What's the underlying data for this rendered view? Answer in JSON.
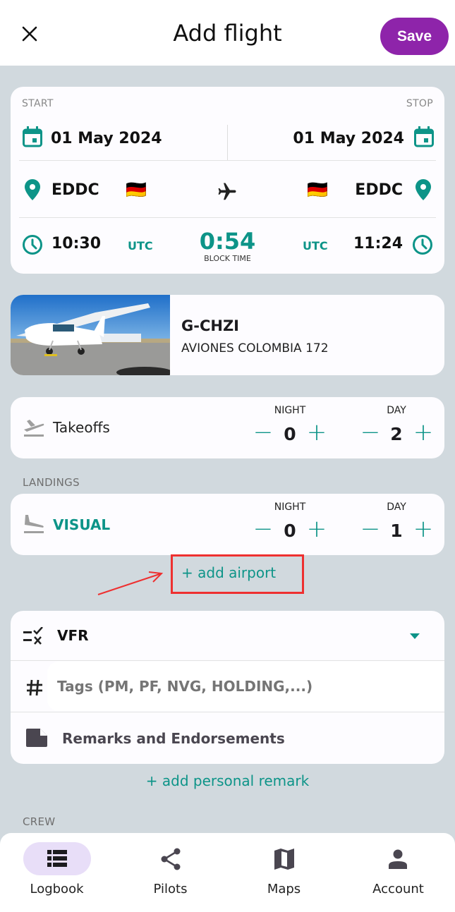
{
  "header": {
    "title": "Add flight",
    "save_label": "Save",
    "close_icon": "close-icon"
  },
  "route": {
    "start_label": "START",
    "stop_label": "STOP",
    "start_date": "01 May 2024",
    "stop_date": "01 May 2024",
    "departure_airport": "EDDC",
    "arrival_airport": "EDDC",
    "departure_flag": "🇩🇪",
    "arrival_flag": "🇩🇪",
    "departure_time": "10:30",
    "arrival_time": "11:24",
    "departure_tz": "UTC",
    "arrival_tz": "UTC",
    "block_time": "0:54",
    "block_time_label": "BLOCK TIME"
  },
  "aircraft": {
    "registration": "G-CHZI",
    "type": "AVIONES COLOMBIA 172"
  },
  "takeoffs": {
    "label": "Takeoffs",
    "night_label": "NIGHT",
    "day_label": "DAY",
    "night_value": "0",
    "day_value": "2"
  },
  "landings": {
    "section_label": "LANDINGS",
    "label": "VISUAL",
    "night_label": "NIGHT",
    "day_label": "DAY",
    "night_value": "0",
    "day_value": "1",
    "add_airport_label": "+ add airport"
  },
  "details": {
    "flight_rules": "VFR",
    "tags_placeholder": "Tags (PM, PF, NVG, HOLDING,...)",
    "remarks_label": "Remarks and Endorsements",
    "add_personal_remark_label": "+ add personal remark"
  },
  "crew": {
    "section_label": "CREW"
  },
  "bottom_nav": {
    "items": [
      {
        "label": "Logbook",
        "icon": "list-icon",
        "active": true
      },
      {
        "label": "Pilots",
        "icon": "share-icon",
        "active": false
      },
      {
        "label": "Maps",
        "icon": "map-icon",
        "active": false
      },
      {
        "label": "Account",
        "icon": "person-icon",
        "active": false
      }
    ]
  },
  "colors": {
    "accent": "#0d9488",
    "primary": "#8e24aa",
    "background": "#d1d9de",
    "annotation": "#ee3030"
  }
}
